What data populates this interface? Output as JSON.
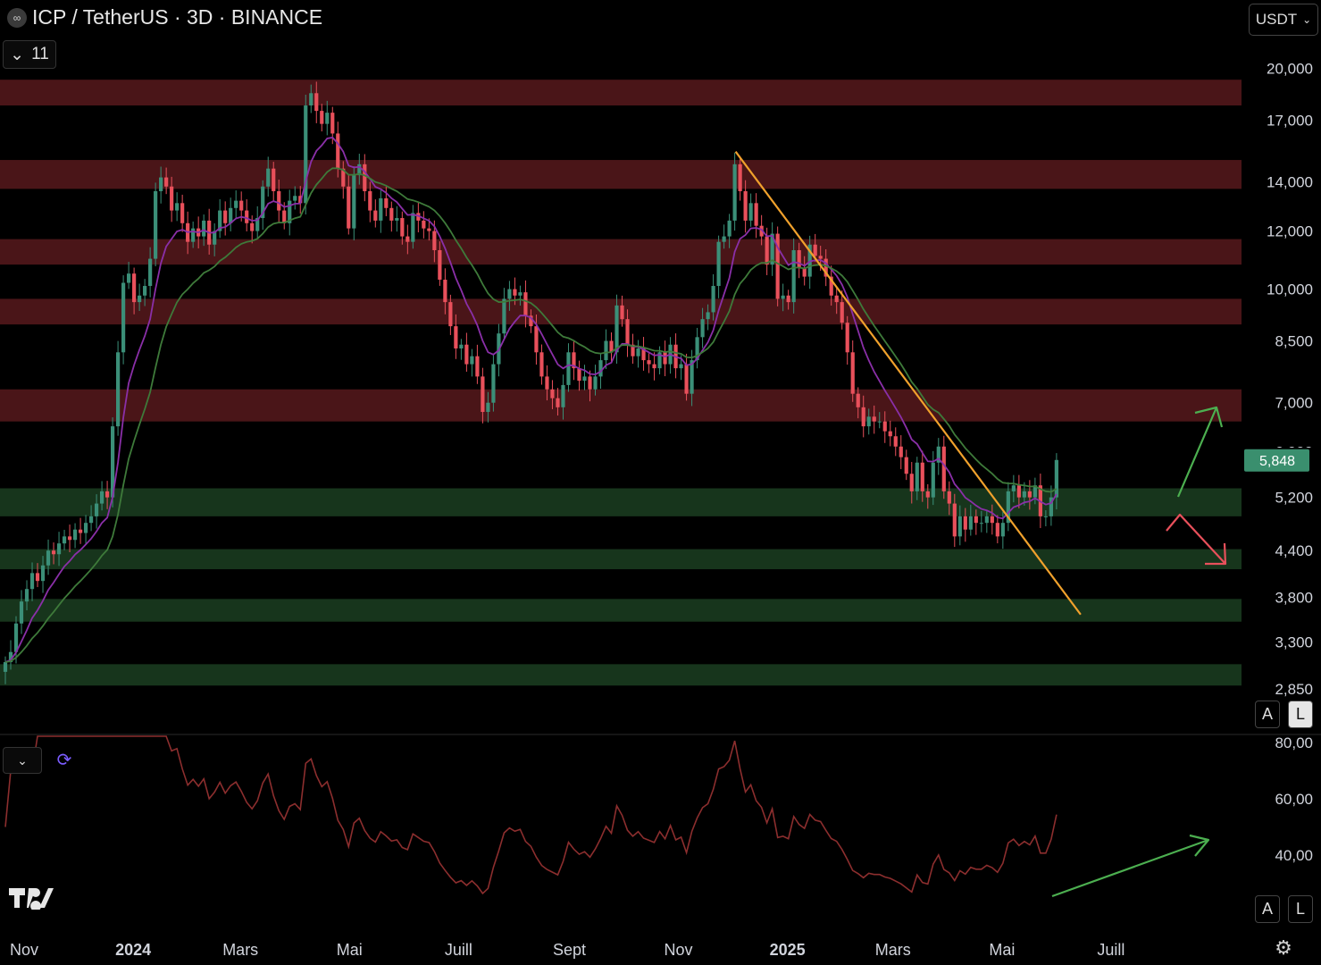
{
  "header": {
    "coin_icon": "icp-logo-icon",
    "title": "ICP / TetherUS · 3D · BINANCE",
    "indicator_count": "11",
    "currency": "USDT"
  },
  "price_badge": {
    "value": "5,848",
    "color": "#3a8f6e"
  },
  "buttons": {
    "auto": "A",
    "log": "L"
  },
  "colors": {
    "bull": "#3b8f78",
    "bear": "#e8505b",
    "ema_fast": "#8a2fa8",
    "ema_slow": "#3e7a3a",
    "trendline": "#f0a12c",
    "resistance_zone": "#4a1518",
    "support_zone": "#17351c",
    "rsi_line": "#8c2e2e",
    "arrow_up": "#4caf50",
    "arrow_down": "#e8505b"
  },
  "chart_data": {
    "type": "candlestick",
    "symbol": "ICP / TetherUS",
    "timeframe": "3D",
    "exchange": "BINANCE",
    "y_scale": "log",
    "ylim": [
      2850,
      20500
    ],
    "y_ticks": [
      "20,000",
      "17,000",
      "14,000",
      "12,000",
      "10,000",
      "8,500",
      "7,000",
      "6,000",
      "5,200",
      "4,400",
      "3,800",
      "3,300",
      "2,850"
    ],
    "x_ticks": [
      "Nov",
      "2024",
      "Mars",
      "Mai",
      "Juill",
      "Sept",
      "Nov",
      "2025",
      "Mars",
      "Mai",
      "Juill"
    ],
    "last_price": 5848,
    "resistance_zones": [
      [
        17800,
        19300
      ],
      [
        13700,
        15000
      ],
      [
        10800,
        11700
      ],
      [
        8950,
        9700
      ],
      [
        6600,
        7300
      ]
    ],
    "support_zones": [
      [
        4900,
        5350
      ],
      [
        4150,
        4420
      ],
      [
        3520,
        3780
      ],
      [
        2880,
        3080
      ]
    ],
    "trendline": {
      "from": [
        "2024-12-03",
        15400
      ],
      "to": [
        "2025-06-14",
        3600
      ]
    },
    "closes": [
      3100,
      3200,
      3500,
      3750,
      3900,
      4100,
      4000,
      4200,
      4400,
      4350,
      4500,
      4600,
      4550,
      4700,
      4650,
      4800,
      4900,
      5100,
      5300,
      5200,
      6500,
      8200,
      10200,
      10500,
      9600,
      9800,
      10100,
      11000,
      13600,
      14200,
      13800,
      12800,
      13100,
      12300,
      11600,
      12100,
      11800,
      12400,
      11500,
      12000,
      12800,
      12300,
      12900,
      13200,
      12800,
      12300,
      12000,
      12500,
      13800,
      14600,
      13600,
      12800,
      12300,
      13200,
      13400,
      13100,
      17800,
      18500,
      17500,
      16800,
      17400,
      16300,
      14600,
      13800,
      12100,
      14300,
      14800,
      13600,
      12800,
      12400,
      13300,
      12900,
      12400,
      12500,
      11800,
      11600,
      12700,
      12400,
      12100,
      12000,
      11300,
      10300,
      9600,
      8900,
      8300,
      8400,
      7900,
      8100,
      7600,
      6800,
      7000,
      7900,
      8700,
      9700,
      10000,
      9800,
      9900,
      9200,
      8900,
      8200,
      7600,
      7300,
      7100,
      6900,
      7400,
      8200,
      7800,
      7500,
      7600,
      7300,
      7600,
      8000,
      8500,
      8200,
      9500,
      9100,
      8400,
      8100,
      8300,
      8000,
      7900,
      7800,
      8200,
      7900,
      8400,
      7800,
      7900,
      7200,
      8000,
      8600,
      9100,
      9300,
      10100,
      11600,
      11800,
      12400,
      14800,
      13600,
      12400,
      13100,
      12200,
      11800,
      10800,
      11900,
      9700,
      9800,
      9600,
      11300,
      10700,
      10400,
      11500,
      11100,
      11000,
      10400,
      9800,
      9600,
      9000,
      8200,
      7200,
      6900,
      6500,
      6700,
      6600,
      6600,
      6400,
      6300,
      6100,
      5900,
      5600,
      5300,
      5800,
      5300,
      5200,
      5800,
      6100,
      5300,
      5100,
      4600,
      4900,
      4700,
      4900,
      4800,
      4800,
      4900,
      4800,
      4600,
      4800,
      5300,
      5400,
      5200,
      5300,
      5200,
      5400,
      4900,
      4900,
      5200,
      5848
    ],
    "rsi": {
      "ylim": [
        20,
        85
      ],
      "y_ticks": [
        "80,00",
        "60,00",
        "40,00"
      ],
      "last": 53
    }
  }
}
